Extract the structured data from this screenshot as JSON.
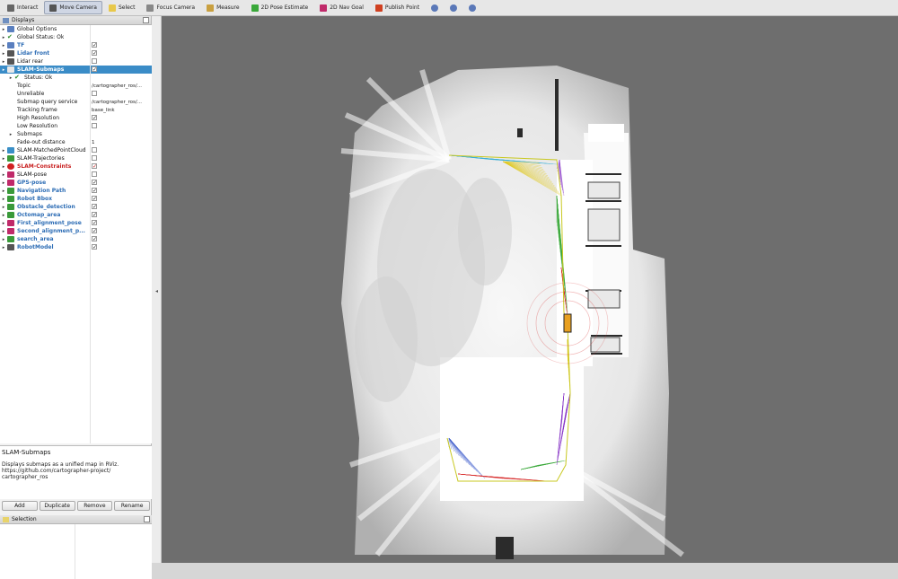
{
  "toolbar": {
    "tools": [
      {
        "id": "interact",
        "label": "Interact",
        "icon": "cursor-icon",
        "active": false
      },
      {
        "id": "move-camera",
        "label": "Move Camera",
        "icon": "move-camera-icon",
        "active": true
      },
      {
        "id": "select",
        "label": "Select",
        "icon": "select-icon",
        "active": false
      },
      {
        "id": "focus-camera",
        "label": "Focus Camera",
        "icon": "focus-camera-icon",
        "active": false
      },
      {
        "id": "measure",
        "label": "Measure",
        "icon": "measure-icon",
        "active": false
      },
      {
        "id": "pose-estimate",
        "label": "2D Pose Estimate",
        "icon": "pose-estimate-icon",
        "active": false
      },
      {
        "id": "nav-goal",
        "label": "2D Nav Goal",
        "icon": "nav-goal-icon",
        "active": false
      },
      {
        "id": "publish-point",
        "label": "Publish Point",
        "icon": "publish-point-icon",
        "active": false
      }
    ]
  },
  "displays_panel": {
    "title": "Displays",
    "rows": [
      {
        "label": "Global Options",
        "indent": 0,
        "expand": true,
        "icon": "globe-icon",
        "icon_color": "#5a7fbf",
        "bold": false,
        "checkbox": null,
        "value": ""
      },
      {
        "label": "Global Status: Ok",
        "indent": 0,
        "expand": true,
        "icon": "checkmark-icon",
        "icon_color": "#2a8a2a",
        "bold": false,
        "checkbox": null,
        "value": ""
      },
      {
        "label": "TF",
        "indent": 0,
        "expand": true,
        "icon": "tf-icon",
        "icon_color": "#5a7fbf",
        "bold": true,
        "color": "#2d6db5",
        "checkbox": true,
        "value": ""
      },
      {
        "label": "Lidar front",
        "indent": 0,
        "expand": true,
        "icon": "laser-scan-icon",
        "icon_color": "#555",
        "bold": true,
        "color": "#2d6db5",
        "checkbox": true,
        "value": ""
      },
      {
        "label": "Lidar rear",
        "indent": 0,
        "expand": true,
        "icon": "laser-scan-icon",
        "icon_color": "#555",
        "bold": false,
        "checkbox": false,
        "value": ""
      },
      {
        "label": "SLAM-Submaps",
        "indent": 0,
        "expand": true,
        "icon": "submaps-icon",
        "icon_color": "#e8e8e8",
        "bold": true,
        "selected": true,
        "checkbox": true,
        "value": ""
      },
      {
        "label": "Status: Ok",
        "indent": 1,
        "expand": true,
        "icon": "checkmark-icon",
        "icon_color": "#2a8a2a",
        "bold": false,
        "checkbox": null,
        "value": ""
      },
      {
        "label": "Topic",
        "indent": 1,
        "expand": false,
        "icon": "",
        "bold": false,
        "checkbox": null,
        "value": "/cartographer_ros/..."
      },
      {
        "label": "Unreliable",
        "indent": 1,
        "expand": false,
        "icon": "",
        "bold": false,
        "checkbox": false,
        "value": ""
      },
      {
        "label": "Submap query service",
        "indent": 1,
        "expand": false,
        "icon": "",
        "bold": false,
        "checkbox": null,
        "value": "/cartographer_ros/..."
      },
      {
        "label": "Tracking frame",
        "indent": 1,
        "expand": false,
        "icon": "",
        "bold": false,
        "checkbox": null,
        "value": "base_link"
      },
      {
        "label": "High Resolution",
        "indent": 1,
        "expand": false,
        "icon": "",
        "bold": false,
        "checkbox": true,
        "value": ""
      },
      {
        "label": "Low Resolution",
        "indent": 1,
        "expand": false,
        "icon": "",
        "bold": false,
        "checkbox": false,
        "value": ""
      },
      {
        "label": "Submaps",
        "indent": 1,
        "expand": true,
        "icon": "",
        "bold": false,
        "checkbox": null,
        "value": ""
      },
      {
        "label": "Fade-out distance",
        "indent": 1,
        "expand": false,
        "icon": "",
        "bold": false,
        "checkbox": null,
        "value": "1"
      },
      {
        "label": "SLAM-MatchedPointCloud",
        "indent": 0,
        "expand": true,
        "icon": "point-cloud-icon",
        "icon_color": "#3a8fc7",
        "bold": false,
        "checkbox": false,
        "value": ""
      },
      {
        "label": "SLAM-Trajectories",
        "indent": 0,
        "expand": true,
        "icon": "marker-array-icon",
        "icon_color": "#3a9a3a",
        "bold": false,
        "checkbox": false,
        "value": ""
      },
      {
        "label": "SLAM-Constraints",
        "indent": 0,
        "expand": true,
        "icon": "error-icon",
        "icon_color": "#d02020",
        "bold": true,
        "color": "#c81e1e",
        "checkbox": true,
        "value": ""
      },
      {
        "label": "SLAM-pose",
        "indent": 0,
        "expand": true,
        "icon": "pose-icon",
        "icon_color": "#c02a6a",
        "bold": false,
        "checkbox": false,
        "value": ""
      },
      {
        "label": "GPS-pose",
        "indent": 0,
        "expand": true,
        "icon": "pose-icon",
        "icon_color": "#c02a6a",
        "bold": true,
        "color": "#2d6db5",
        "checkbox": true,
        "value": ""
      },
      {
        "label": "Navigation Path",
        "indent": 0,
        "expand": true,
        "icon": "path-icon",
        "icon_color": "#3a9a3a",
        "bold": true,
        "color": "#2d6db5",
        "checkbox": true,
        "value": ""
      },
      {
        "label": "Robot Bbox",
        "indent": 0,
        "expand": true,
        "icon": "marker-array-icon",
        "icon_color": "#3a9a3a",
        "bold": true,
        "color": "#2d6db5",
        "checkbox": true,
        "value": ""
      },
      {
        "label": "Obstacle_detection",
        "indent": 0,
        "expand": true,
        "icon": "marker-array-icon",
        "icon_color": "#3a9a3a",
        "bold": true,
        "color": "#2d6db5",
        "checkbox": true,
        "value": ""
      },
      {
        "label": "Octomap_area",
        "indent": 0,
        "expand": true,
        "icon": "polygon-icon",
        "icon_color": "#3a9a3a",
        "bold": true,
        "color": "#2d6db5",
        "checkbox": true,
        "value": ""
      },
      {
        "label": "First_alignment_pose",
        "indent": 0,
        "expand": true,
        "icon": "pose-icon",
        "icon_color": "#c02a6a",
        "bold": true,
        "color": "#2d6db5",
        "checkbox": true,
        "value": ""
      },
      {
        "label": "Second_alignment_p...",
        "indent": 0,
        "expand": true,
        "icon": "pose-icon",
        "icon_color": "#c02a6a",
        "bold": true,
        "color": "#2d6db5",
        "checkbox": true,
        "value": ""
      },
      {
        "label": "search_area",
        "indent": 0,
        "expand": true,
        "icon": "polygon-icon",
        "icon_color": "#3a9a3a",
        "bold": true,
        "color": "#2d6db5",
        "checkbox": true,
        "value": ""
      },
      {
        "label": "RobotModel",
        "indent": 0,
        "expand": true,
        "icon": "robot-model-icon",
        "icon_color": "#555",
        "bold": true,
        "color": "#2d6db5",
        "checkbox": true,
        "value": ""
      }
    ]
  },
  "description": {
    "title": "SLAM-Submaps",
    "body": "Displays submaps as a unified map in RViz. https://github.com/cartographer-project/ cartographer_ros"
  },
  "buttons": {
    "add": "Add",
    "duplicate": "Duplicate",
    "remove": "Remove",
    "rename": "Rename"
  },
  "selection_panel": {
    "title": "Selection"
  },
  "viewport": {
    "background": "#6e6e6e",
    "constraint_colors": [
      "#3bb0d8",
      "#e0c81a",
      "#8a3ac8",
      "#3aa83a",
      "#d83030",
      "#3050c8"
    ]
  }
}
